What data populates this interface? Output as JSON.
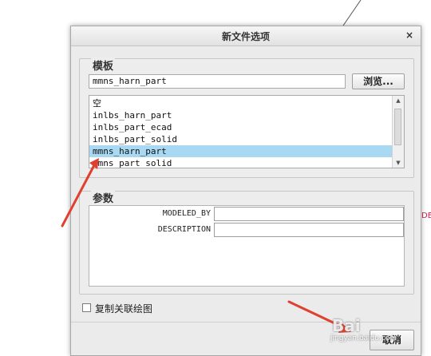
{
  "dialog": {
    "title": "新文件选项",
    "close_label": "×"
  },
  "template_group": {
    "title": "模板",
    "input_value": "mmns_harn_part",
    "browse_label": "浏览...",
    "items": [
      {
        "label": "空",
        "selected": false
      },
      {
        "label": "inlbs_harn_part",
        "selected": false
      },
      {
        "label": "inlbs_part_ecad",
        "selected": false
      },
      {
        "label": "inlbs_part_solid",
        "selected": false
      },
      {
        "label": "mmns_harn_part",
        "selected": true
      },
      {
        "label": "mmns_part_solid",
        "selected": false
      }
    ]
  },
  "params_group": {
    "title": "参数",
    "params": [
      {
        "label": "MODELED_BY",
        "value": ""
      },
      {
        "label": "DESCRIPTION",
        "value": ""
      }
    ]
  },
  "options": {
    "copy_drawing_label": "复制关联绘图",
    "copy_drawing_checked": false
  },
  "buttons": {
    "cancel_label": "取消"
  },
  "background": {
    "edge_text": "DE"
  },
  "watermark": {
    "logo": "Bai",
    "text": "jingyan.baidu.com"
  },
  "colors": {
    "selection": "#a9d9f2",
    "arrow": "#e0402f"
  }
}
